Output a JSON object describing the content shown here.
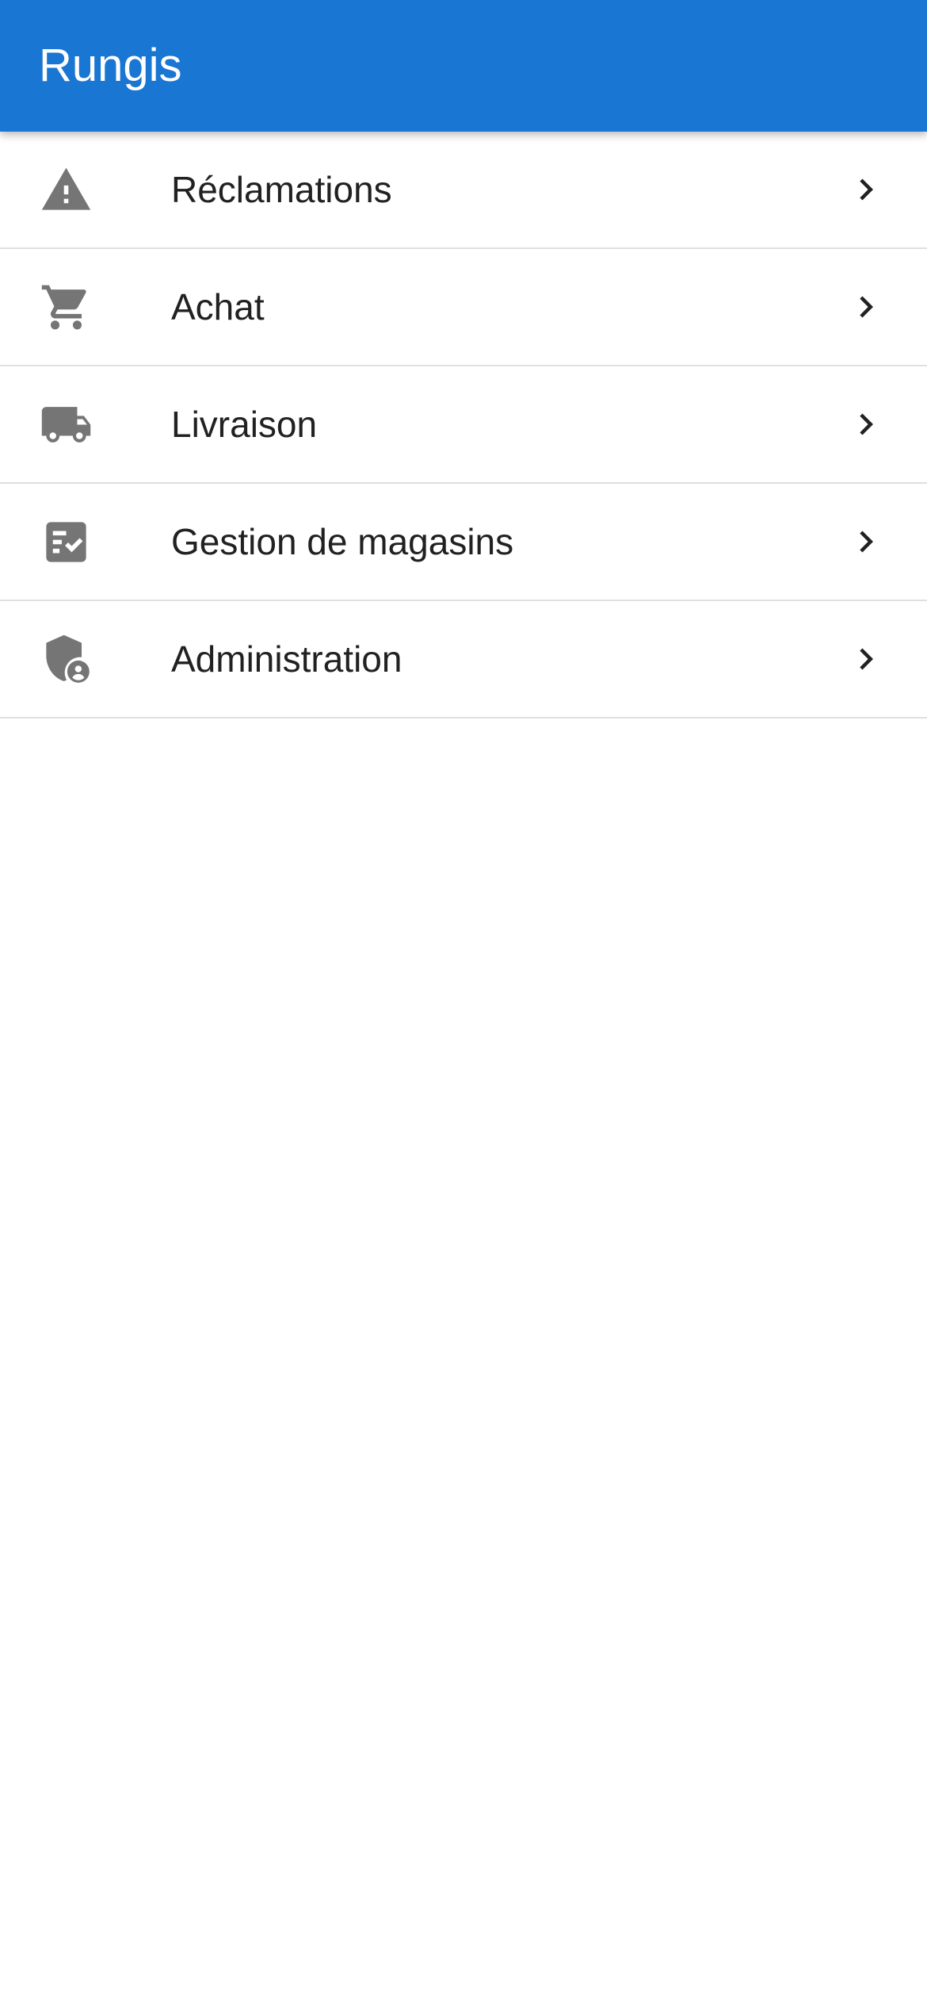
{
  "app_bar": {
    "title": "Rungis",
    "background_color": "#1976D2"
  },
  "menu": {
    "items": [
      {
        "label": "Réclamations",
        "icon": "warning-icon"
      },
      {
        "label": "Achat",
        "icon": "shopping-cart-icon"
      },
      {
        "label": "Livraison",
        "icon": "truck-icon"
      },
      {
        "label": "Gestion de magasins",
        "icon": "checklist-icon"
      },
      {
        "label": "Administration",
        "icon": "admin-shield-icon"
      }
    ],
    "trailing_icon": "chevron-right-icon",
    "icon_color": "#757575",
    "text_color": "#212121"
  }
}
